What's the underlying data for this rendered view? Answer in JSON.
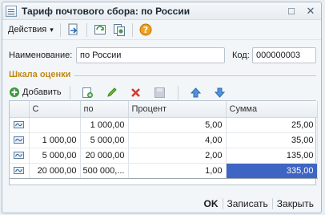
{
  "window": {
    "title": "Тариф почтового сбора: по России",
    "controls": [
      "□",
      "✕"
    ]
  },
  "toolbar": {
    "actions_label": "Действия",
    "actions_caret": "▾",
    "icons": [
      "doc-arrow-icon",
      "refresh-doc-icon",
      "copy-doc-icon",
      "help-icon"
    ]
  },
  "form": {
    "name_label": "Наименование:",
    "name_value": "по России",
    "code_label": "Код:",
    "code_value": "000000003"
  },
  "section": {
    "title": "Шкала оценки"
  },
  "grid_toolbar": {
    "add_label": "Добавить",
    "icons": [
      "add-copy-icon",
      "edit-icon",
      "delete-icon",
      "save-icon",
      "move-up-icon",
      "move-down-icon"
    ]
  },
  "grid": {
    "columns": [
      "",
      "С",
      "по",
      "Процент",
      "Сумма"
    ],
    "rows": [
      {
        "from": "",
        "to": "1 000,00",
        "percent": "5,00",
        "sum": "25,00"
      },
      {
        "from": "1 000,00",
        "to": "5 000,00",
        "percent": "4,00",
        "sum": "35,00"
      },
      {
        "from": "5 000,00",
        "to": "20 000,00",
        "percent": "2,00",
        "sum": "135,00"
      },
      {
        "from": "20 000,00",
        "to": "500 000,...",
        "percent": "1,00",
        "sum": "335,00"
      }
    ]
  },
  "bottom": {
    "ok_label": "OK",
    "save_label": "Записать",
    "close_label": "Закрыть"
  },
  "colors": {
    "accent_section": "#c08a1b",
    "selection": "#3e64c4"
  }
}
